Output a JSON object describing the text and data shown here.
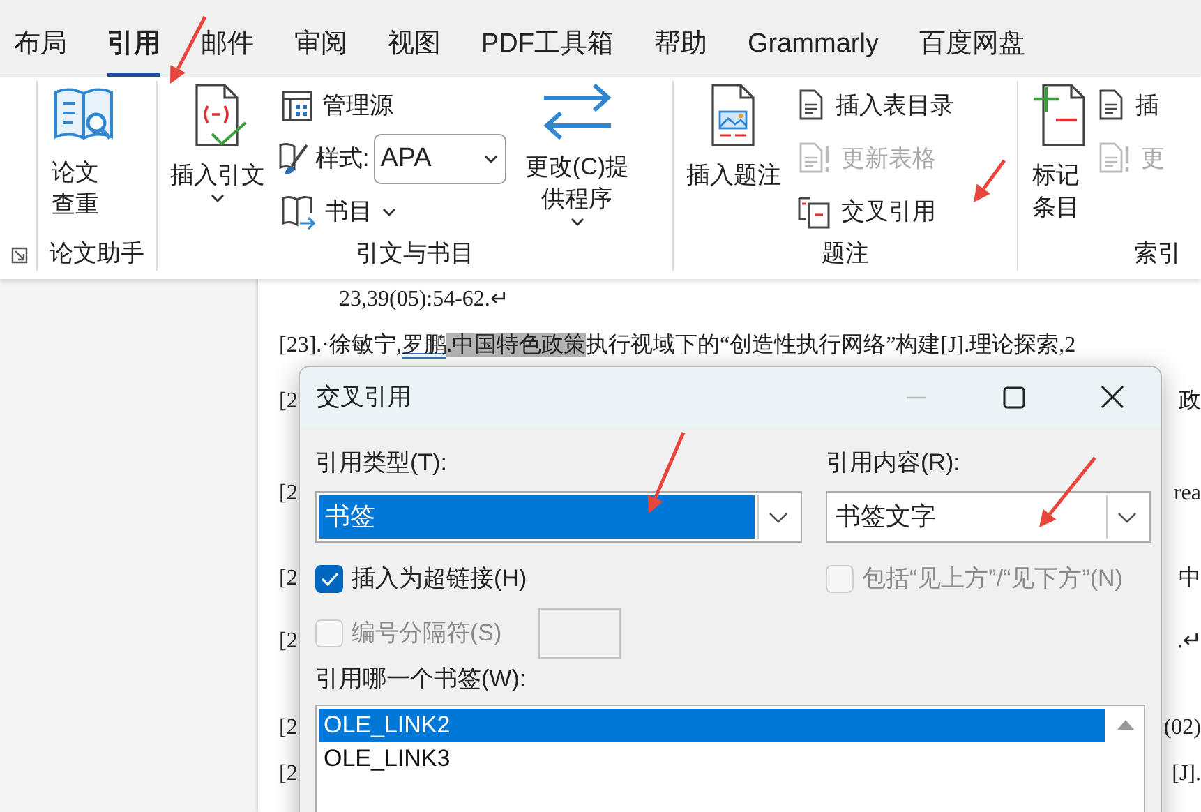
{
  "tabs": [
    {
      "label": "布局",
      "selected": false
    },
    {
      "label": "引用",
      "selected": true
    },
    {
      "label": "邮件",
      "selected": false
    },
    {
      "label": "审阅",
      "selected": false
    },
    {
      "label": "视图",
      "selected": false
    },
    {
      "label": "PDF工具箱",
      "selected": false
    },
    {
      "label": "帮助",
      "selected": false
    },
    {
      "label": "Grammarly",
      "selected": false
    },
    {
      "label": "百度网盘",
      "selected": false
    }
  ],
  "ribbon": {
    "groups": [
      {
        "label": "论文助手",
        "items": [
          {
            "kind": "large",
            "label": "论文查重",
            "caret": false
          }
        ]
      },
      {
        "label": "引文与书目",
        "items": [
          {
            "kind": "large",
            "label": "插入引文",
            "caret": true
          },
          {
            "kind": "stack",
            "items": [
              {
                "kind": "small",
                "label": "管理源",
                "caret": false,
                "disabled": false
              },
              {
                "kind": "combo",
                "label": "样式:",
                "value": "APA"
              },
              {
                "kind": "small",
                "label": "书目",
                "caret": true,
                "disabled": false
              }
            ]
          },
          {
            "kind": "large",
            "label": "更改(C)提供程序",
            "caret": true
          }
        ]
      },
      {
        "label": "题注",
        "items": [
          {
            "kind": "large",
            "label": "插入题注",
            "caret": false
          },
          {
            "kind": "stack",
            "items": [
              {
                "kind": "small",
                "label": "插入表目录",
                "caret": false,
                "disabled": false
              },
              {
                "kind": "small",
                "label": "更新表格",
                "caret": false,
                "disabled": true
              },
              {
                "kind": "small",
                "label": "交叉引用",
                "caret": false,
                "disabled": false
              }
            ]
          }
        ]
      },
      {
        "label": "索引",
        "items": [
          {
            "kind": "large",
            "label": "标记条目",
            "caret": false
          },
          {
            "kind": "stack",
            "items": [
              {
                "kind": "small",
                "label": "插",
                "caret": false,
                "disabled": false
              },
              {
                "kind": "small",
                "label": "更",
                "caret": false,
                "disabled": true
              }
            ]
          }
        ]
      }
    ]
  },
  "document": {
    "lines": [
      {
        "kind": "continuation",
        "segments": [
          {
            "kind": "plain",
            "text": "23,39(05):54-62.↵"
          }
        ]
      },
      {
        "kind": "entry",
        "segments": [
          {
            "kind": "plain",
            "text": "[23].·徐敏宁,"
          },
          {
            "kind": "flagged",
            "text": "罗鹏"
          },
          {
            "kind": "shaded",
            "text": ".中国特色政策"
          },
          {
            "kind": "plain",
            "text": "执行视域下的“创造性执行网络”构建[J].理论探索,2"
          }
        ]
      },
      {
        "kind": "entry",
        "segments": [
          {
            "kind": "plain",
            "text": "[2"
          }
        ],
        "tail": "政"
      },
      {
        "kind": "entry",
        "segments": [
          {
            "kind": "plain",
            "text": "[2"
          }
        ],
        "tail": "rea"
      },
      {
        "kind": "entry",
        "segments": [
          {
            "kind": "plain",
            "text": "[2"
          }
        ],
        "tail": "中"
      },
      {
        "kind": "entry",
        "segments": [
          {
            "kind": "plain",
            "text": "[2"
          }
        ],
        "tail": ".↵"
      },
      {
        "kind": "entry",
        "segments": [
          {
            "kind": "plain",
            "text": "[2"
          }
        ],
        "tail": "(02)"
      },
      {
        "kind": "entry",
        "segments": [
          {
            "kind": "plain",
            "text": "[2"
          }
        ],
        "tail": "[J]."
      }
    ]
  },
  "dialog": {
    "title": "交叉引用",
    "type_label": "引用类型(T):",
    "type_select": {
      "value": "书签",
      "focused": true
    },
    "content_label": "引用内容(R):",
    "content_select": {
      "value": "书签文字",
      "focused": false
    },
    "checkboxes": [
      {
        "label": "插入为超链接(H)",
        "checked": true,
        "disabled": false
      },
      {
        "label": "包括“见上方”/“见下方”(N)",
        "checked": false,
        "disabled": true
      },
      {
        "label": "编号分隔符(S)",
        "checked": false,
        "disabled": true
      }
    ],
    "separator_field": {
      "disabled": true
    },
    "list_label": "引用哪一个书签(W):",
    "bookmarks": [
      {
        "label": "OLE_LINK2",
        "selected": true
      },
      {
        "label": "OLE_LINK3",
        "selected": false
      }
    ]
  }
}
